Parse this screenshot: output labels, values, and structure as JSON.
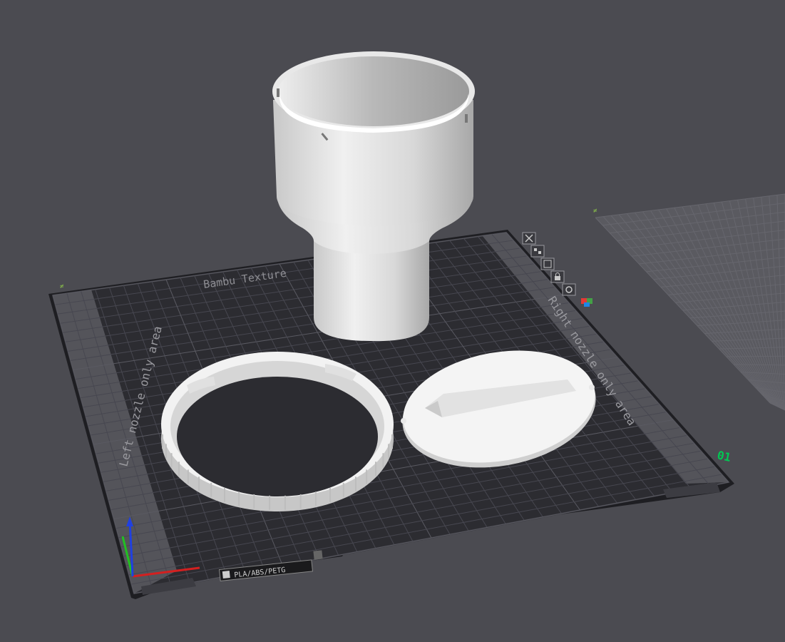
{
  "app": {
    "title": ""
  },
  "plate": {
    "brand_text": "Bambu Texture",
    "left_zone_label": "Left nozzle only area",
    "right_zone_label": "Right nozzle only area",
    "plate_number": "01",
    "filament_tag": "PLA/ABS/PETG",
    "side_marker_left": "≠",
    "side_marker_right": "≠"
  },
  "plate_toolbar": {
    "icons": [
      "close-icon",
      "auto-arrange-icon",
      "orient-icon",
      "lock-icon",
      "settings-icon",
      "filament-color-icon"
    ]
  },
  "objects": [
    "cup-holder-body",
    "threaded-ring",
    "round-lid"
  ],
  "colors": {
    "background": "#4b4b51",
    "plate": "#2a2a2e",
    "plate_border": "#1a1a1c",
    "grid_line": "#4a4a50",
    "nozzle_zone": "#56565c",
    "model": "#e6e6e6",
    "plate_number": "#00c853",
    "axis_x": "#d32020",
    "axis_y": "#21c021",
    "axis_z": "#2040e0"
  }
}
